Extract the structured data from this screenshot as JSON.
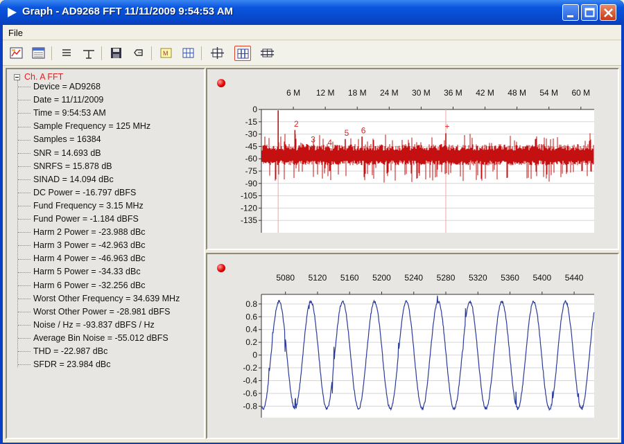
{
  "window": {
    "title": "Graph - AD9268 FFT 11/11/2009 9:54:53 AM"
  },
  "menu": {
    "file": "File"
  },
  "toolbar": {
    "icons": [
      "chart-icon",
      "table-icon",
      "list-icon",
      "split-icon",
      "save-icon",
      "undo-icon",
      "marker-icon",
      "grid-icon",
      "zoom-both-icon",
      "zoom-x-icon",
      "zoom-y-icon"
    ],
    "active_icon": "zoom-x-icon"
  },
  "tree": {
    "root": "Ch. A FFT",
    "items": [
      "Device = AD9268",
      "Date = 11/11/2009",
      "Time = 9:54:53 AM",
      "Sample Frequency = 125 MHz",
      "Samples = 16384",
      "SNR = 14.693 dB",
      "SNRFS = 15.878 dB",
      "SINAD = 14.094 dBc",
      "DC Power = -16.797 dBFS",
      "Fund Frequency = 3.15 MHz",
      "Fund Power = -1.184 dBFS",
      "Harm 2 Power = -23.988 dBc",
      "Harm 3 Power = -42.963 dBc",
      "Harm 4 Power = -46.963 dBc",
      "Harm 5 Power = -34.33 dBc",
      "Harm 6 Power = -32.256 dBc",
      "Worst Other Frequency = 34.639 MHz",
      "Worst Other Power = -28.981 dBFS",
      "Noise / Hz = -93.837 dBFS / Hz",
      "Average Bin Noise = -55.012 dBFS",
      "THD = -22.987 dBc",
      "SFDR = 23.984 dBc"
    ]
  },
  "colors": {
    "fft_trace": "#c41010",
    "time_trace": "#2a3a9a",
    "harmonic_label": "#e02424"
  },
  "chart_data": [
    {
      "type": "line",
      "x_tick_labels": [
        "6 M",
        "12 M",
        "18 M",
        "24 M",
        "30 M",
        "36 M",
        "42 M",
        "48 M",
        "54 M",
        "60 M"
      ],
      "x_ticks": [
        6,
        12,
        18,
        24,
        30,
        36,
        42,
        48,
        54,
        60
      ],
      "xlim": [
        0,
        62.5
      ],
      "y_tick_labels": [
        "0",
        "-15",
        "-30",
        "-45",
        "-60",
        "-75",
        "-90",
        "-105",
        "-120",
        "-135"
      ],
      "y_ticks": [
        0,
        -15,
        -30,
        -45,
        -60,
        -75,
        -90,
        -105,
        -120,
        -135
      ],
      "ylim": [
        -150,
        0
      ],
      "x_axis_position": "top",
      "grid": true,
      "noise_floor": -58,
      "peaks": [
        {
          "x": 3.15,
          "y": -1.2
        },
        {
          "x": 6.3,
          "y": -25
        },
        {
          "x": 9.45,
          "y": -44
        },
        {
          "x": 12.6,
          "y": -48
        },
        {
          "x": 15.75,
          "y": -36
        },
        {
          "x": 18.9,
          "y": -33
        },
        {
          "x": 34.64,
          "y": -29
        }
      ],
      "harmonic_labels": [
        {
          "text": "2",
          "x": 6.3,
          "y": -21
        },
        {
          "text": "3",
          "x": 9.45,
          "y": -40
        },
        {
          "text": "4",
          "x": 12.6,
          "y": -44
        },
        {
          "text": "5",
          "x": 15.75,
          "y": -32
        },
        {
          "text": "6",
          "x": 18.9,
          "y": -29
        },
        {
          "text": "+",
          "x": 34.64,
          "y": -24
        }
      ],
      "markers": [
        3.15,
        34.64
      ]
    },
    {
      "type": "line",
      "x_tick_labels": [
        "5080",
        "5120",
        "5160",
        "5200",
        "5240",
        "5280",
        "5320",
        "5360",
        "5400",
        "5440"
      ],
      "x_ticks": [
        5080,
        5120,
        5160,
        5200,
        5240,
        5280,
        5320,
        5360,
        5400,
        5440
      ],
      "xlim": [
        5050,
        5465
      ],
      "y_tick_labels": [
        "0.8",
        "0.6",
        "0.4",
        "0.2",
        "0",
        "-0.2",
        "-0.4",
        "-0.6",
        "-0.8"
      ],
      "y_ticks": [
        0.8,
        0.6,
        0.4,
        0.2,
        0,
        -0.2,
        -0.4,
        -0.6,
        -0.8
      ],
      "ylim": [
        -0.98,
        0.95
      ],
      "x_axis_position": "top",
      "grid": true,
      "amplitude": 0.84,
      "period": 39.7
    }
  ]
}
